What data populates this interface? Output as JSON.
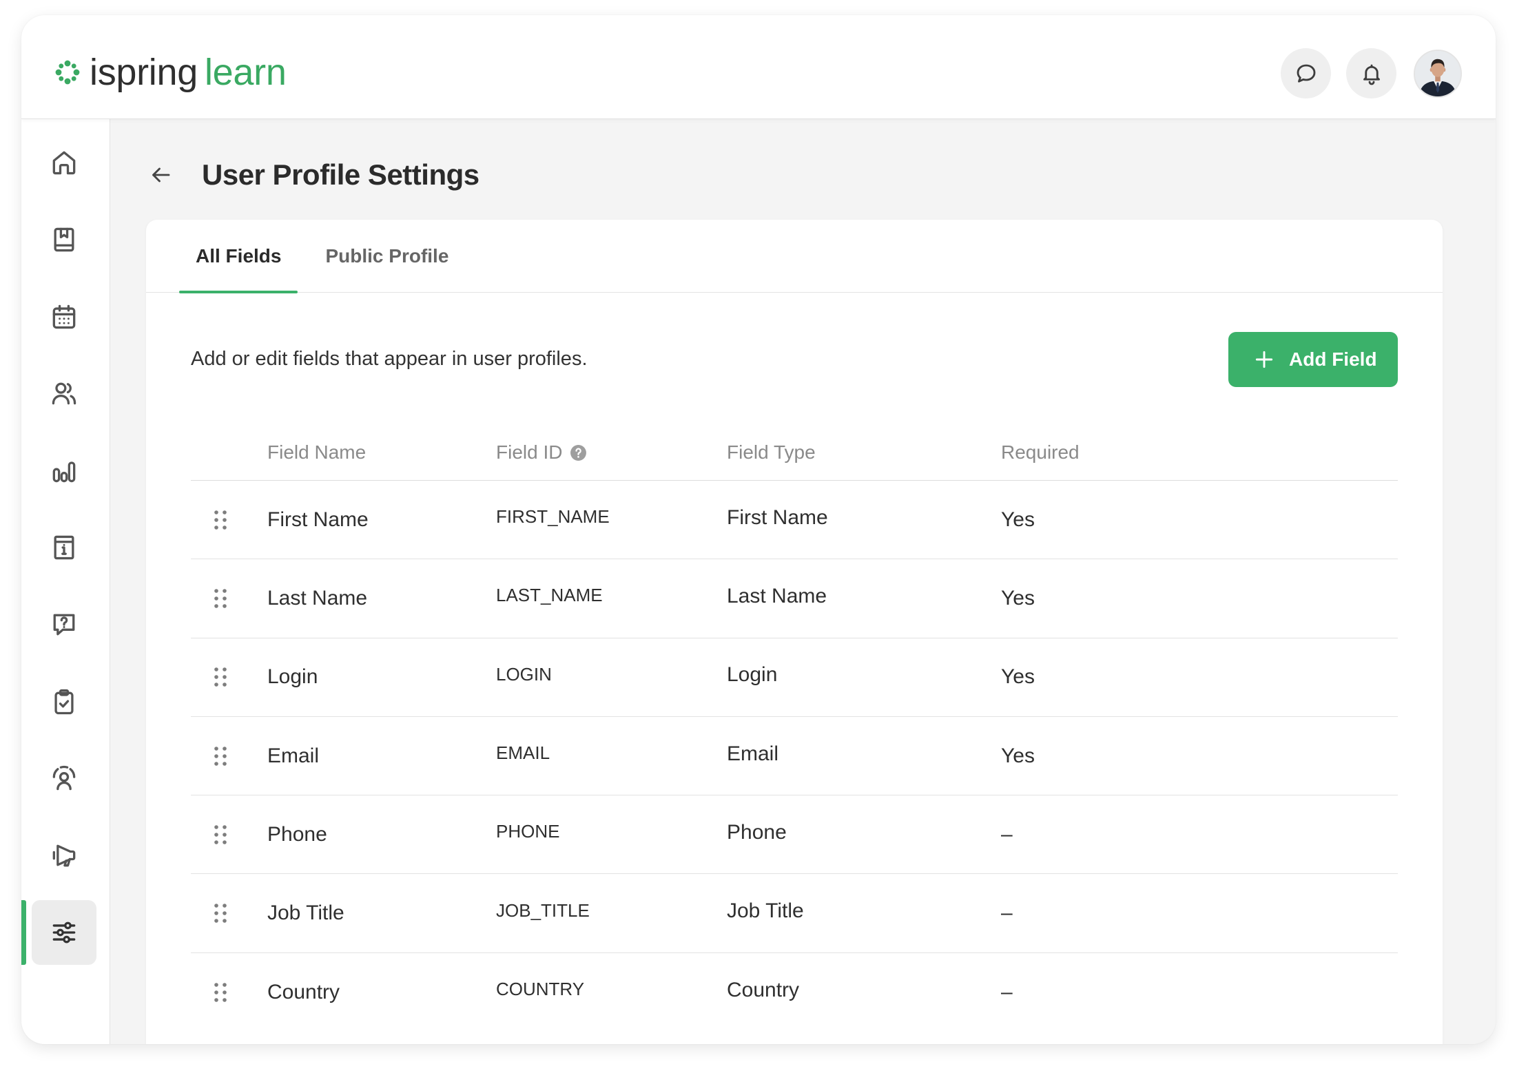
{
  "colors": {
    "accent": "#3bb16a",
    "logo_product": "#3aa962",
    "main_background": "#f4f4f4"
  },
  "logo": {
    "icon": "ispring-logo-icon",
    "brand": "ispring",
    "product": "learn"
  },
  "header": {
    "buttons": [
      {
        "icon": "chat-icon"
      },
      {
        "icon": "bell-icon"
      }
    ]
  },
  "sidebar": {
    "items": [
      {
        "icon": "home-icon",
        "active": false
      },
      {
        "icon": "book-icon",
        "active": false
      },
      {
        "icon": "calendar-icon",
        "active": false
      },
      {
        "icon": "users-icon",
        "active": false
      },
      {
        "icon": "bar-chart-icon",
        "active": false
      },
      {
        "icon": "info-document-icon",
        "active": false
      },
      {
        "icon": "question-bubble-icon",
        "active": false
      },
      {
        "icon": "clipboard-check-icon",
        "active": false
      },
      {
        "icon": "user-broadcast-icon",
        "active": false
      },
      {
        "icon": "megaphone-icon",
        "active": false
      },
      {
        "icon": "sliders-icon",
        "active": true
      }
    ]
  },
  "page": {
    "back_icon": "arrow-left-icon",
    "title": "User Profile Settings"
  },
  "tabs": [
    {
      "label": "All Fields",
      "active": true
    },
    {
      "label": "Public Profile",
      "active": false
    }
  ],
  "description": "Add or edit fields that appear in user profiles.",
  "add_button": {
    "icon": "plus-icon",
    "label": "Add Field"
  },
  "table": {
    "columns": [
      "Field Name",
      "Field ID",
      "Field Type",
      "Required"
    ],
    "field_id_help_icon": "help-icon",
    "rows": [
      {
        "field_name": "First Name",
        "field_id": "FIRST_NAME",
        "field_type": "First Name",
        "required": "Yes"
      },
      {
        "field_name": "Last Name",
        "field_id": "LAST_NAME",
        "field_type": "Last Name",
        "required": "Yes"
      },
      {
        "field_name": "Login",
        "field_id": "LOGIN",
        "field_type": "Login",
        "required": "Yes"
      },
      {
        "field_name": "Email",
        "field_id": "EMAIL",
        "field_type": "Email",
        "required": "Yes"
      },
      {
        "field_name": "Phone",
        "field_id": "PHONE",
        "field_type": "Phone",
        "required": "–"
      },
      {
        "field_name": "Job Title",
        "field_id": "JOB_TITLE",
        "field_type": "Job Title",
        "required": "–"
      },
      {
        "field_name": "Country",
        "field_id": "COUNTRY",
        "field_type": "Country",
        "required": "–"
      }
    ]
  }
}
